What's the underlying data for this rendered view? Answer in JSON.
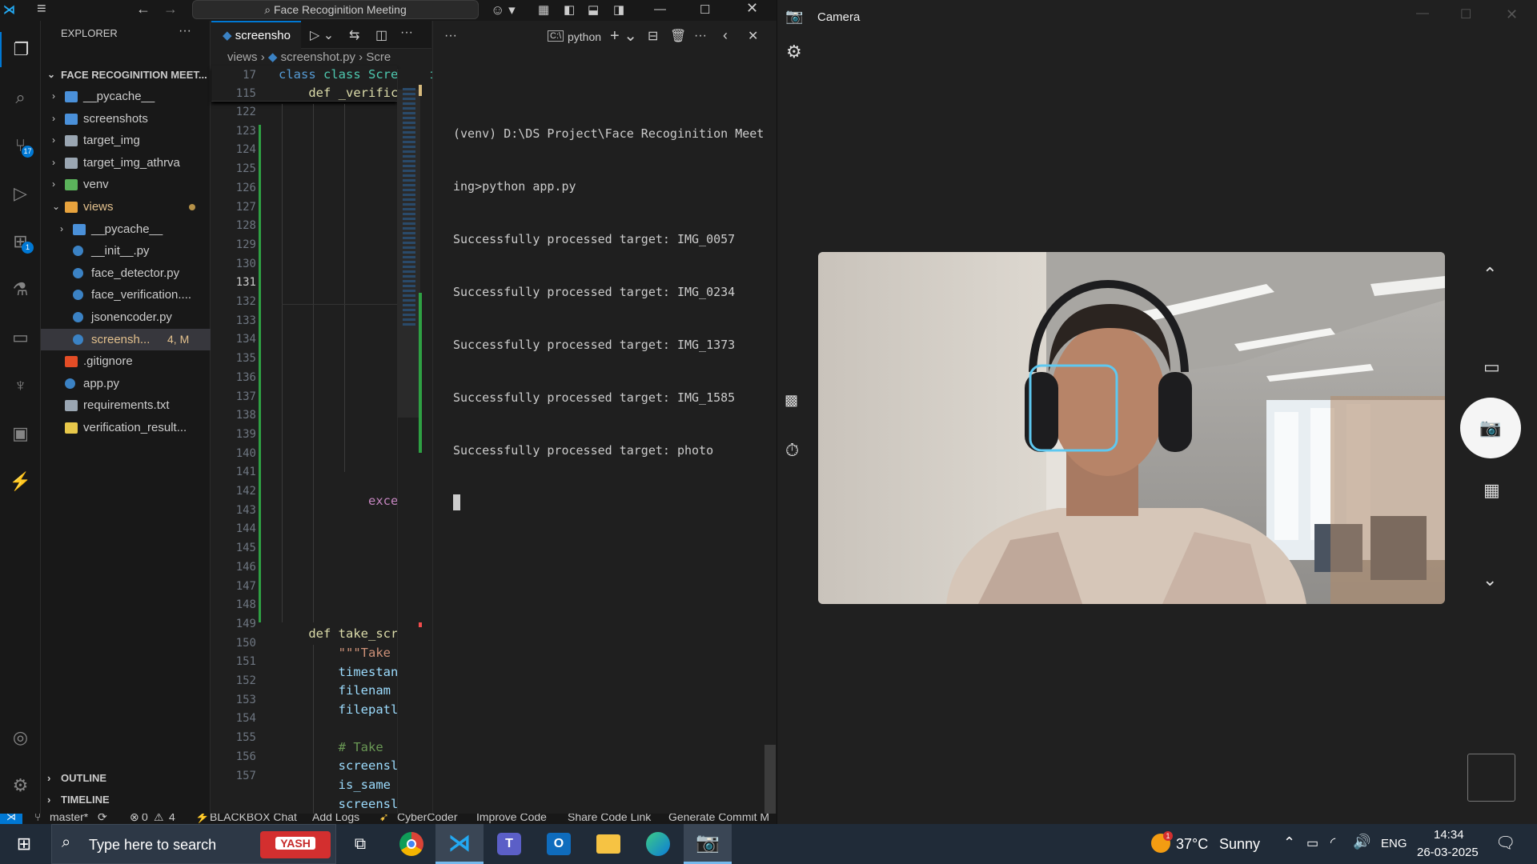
{
  "vscode": {
    "command_center": "Face Recoginition Meeting",
    "explorer_title": "EXPLORER",
    "project_name": "FACE RECOGINITION MEET...",
    "source_control_badge": "17",
    "extensions_badge": "1",
    "tree": [
      {
        "label": "__pycache__",
        "kind": "folder",
        "color": "#4a90d9"
      },
      {
        "label": "screenshots",
        "kind": "folder",
        "color": "#4a90d9"
      },
      {
        "label": "target_img",
        "kind": "folder",
        "color": "#9aa6b2"
      },
      {
        "label": "target_img_athrva",
        "kind": "folder",
        "color": "#9aa6b2"
      },
      {
        "label": "venv",
        "kind": "folder",
        "color": "#5bb35b"
      },
      {
        "label": "views",
        "kind": "folder-open",
        "color": "#e8a33d"
      },
      {
        "label": "__pycache__",
        "kind": "folder",
        "color": "#4a90d9"
      },
      {
        "label": "__init__.py",
        "kind": "python",
        "color": "#3b82c4"
      },
      {
        "label": "face_detector.py",
        "kind": "python",
        "color": "#3b82c4"
      },
      {
        "label": "face_verification....",
        "kind": "python",
        "color": "#3b82c4"
      },
      {
        "label": "jsonencoder.py",
        "kind": "python",
        "color": "#3b82c4"
      },
      {
        "label": "screensh...",
        "kind": "python",
        "color": "#3b82c4",
        "status": "4, M"
      },
      {
        "label": ".gitignore",
        "kind": "git",
        "color": "#e44d26"
      },
      {
        "label": "app.py",
        "kind": "python",
        "color": "#3b82c4"
      },
      {
        "label": "requirements.txt",
        "kind": "text",
        "color": "#9aa6b2"
      },
      {
        "label": "verification_result...",
        "kind": "json",
        "color": "#e8c84a"
      }
    ],
    "outline_label": "OUTLINE",
    "timeline_label": "TIMELINE",
    "tab_label": "screensho",
    "breadcrumb": {
      "folder": "views",
      "file": "screenshot.py",
      "symbol": "Scre"
    },
    "sticky_lines": [
      {
        "num": "17",
        "text": "class Screenshot"
      },
      {
        "num": "115",
        "text": "    def _verific"
      }
    ],
    "line_numbers": [
      "122",
      "123",
      "124",
      "125",
      "126",
      "127",
      "128",
      "129",
      "130",
      "131",
      "132",
      "133",
      "134",
      "135",
      "136",
      "137",
      "138",
      "139",
      "140",
      "141",
      "142",
      "143",
      "144",
      "145",
      "146",
      "147",
      "148",
      "149",
      "150",
      "151",
      "152",
      "153",
      "154",
      "155",
      "156",
      "157"
    ],
    "current_line": "131",
    "code_lines": {
      "exc": "            exce",
      "def_take": "    def take_scr",
      "doc": "        \"\"\"Take",
      "timestamp": "        timestan",
      "filename": "        filenam",
      "filepath": "        filepatl",
      "comment": "        # Take ",
      "screens1": "        screensl",
      "is_same": "        is_same",
      "screens2": "        screensl"
    },
    "terminal": {
      "profile": "python",
      "lines": [
        "(venv) D:\\DS Project\\Face Recoginition Meet",
        "ing>python app.py",
        "Successfully processed target: IMG_0057",
        "Successfully processed target: IMG_0234",
        "Successfully processed target: IMG_1373",
        "Successfully processed target: IMG_1585",
        "Successfully processed target: photo"
      ]
    },
    "status": {
      "branch": "master*",
      "errors": "0",
      "warnings": "4",
      "items": [
        "BLACKBOX Chat",
        "Add Logs",
        "CyberCoder",
        "Improve Code",
        "Share Code Link",
        "Generate Commit M"
      ]
    }
  },
  "camera": {
    "title": "Camera"
  },
  "taskbar": {
    "search_placeholder": "Type here to search",
    "yash_label": "YASH",
    "weather_temp": "37°C",
    "weather_text": "Sunny",
    "weather_badge": "1",
    "language": "ENG",
    "time": "14:34",
    "date": "26-03-2025"
  }
}
